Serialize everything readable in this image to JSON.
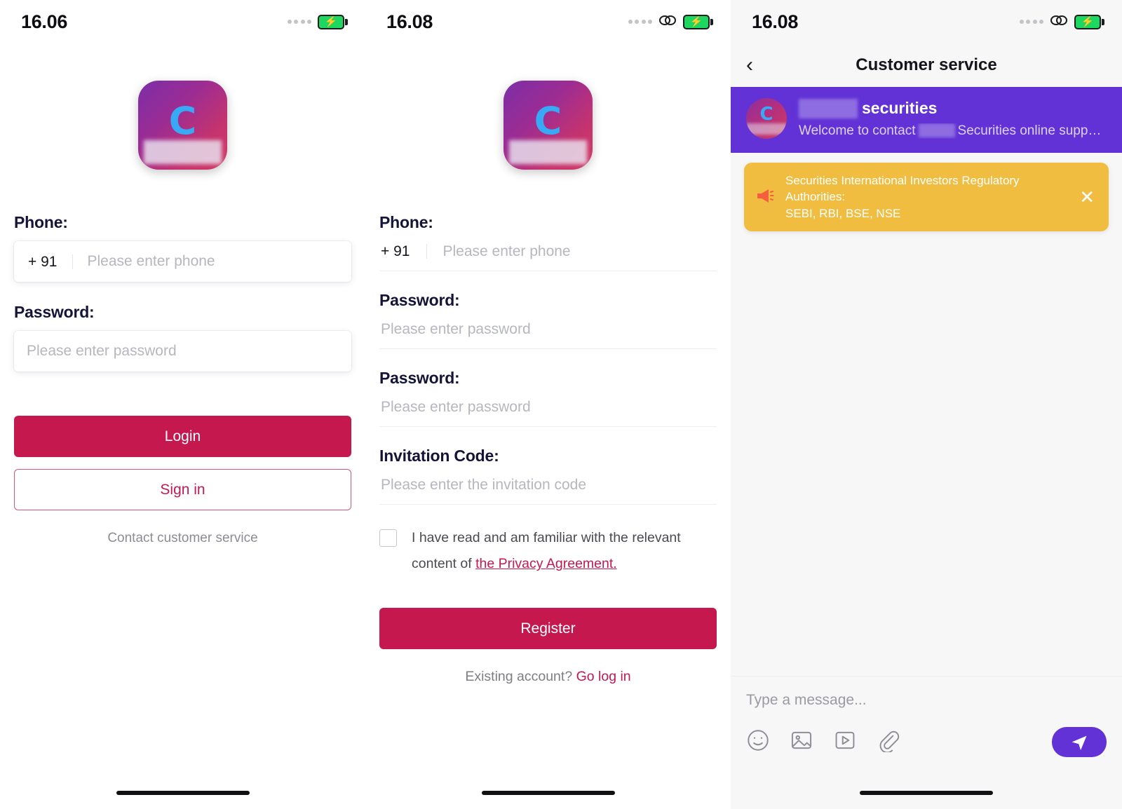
{
  "login": {
    "status": {
      "time": "16.06",
      "battery_state": "charging",
      "has_chain_icon": false
    },
    "logo": {
      "letter": "C",
      "redacted": true
    },
    "phone_label": "Phone:",
    "country_code": "+ 91",
    "phone_placeholder": "Please enter phone",
    "password_label": "Password:",
    "password_placeholder": "Please enter password",
    "login_button": "Login",
    "signin_button": "Sign in",
    "contact_link": "Contact customer service"
  },
  "register": {
    "status": {
      "time": "16.08",
      "battery_state": "charging",
      "has_chain_icon": true
    },
    "logo": {
      "letter": "C",
      "redacted": true
    },
    "phone_label": "Phone:",
    "country_code": "+ 91",
    "phone_placeholder": "Please enter phone",
    "password_label": "Password:",
    "password_placeholder": "Please enter password",
    "confirm_label": "Password:",
    "confirm_placeholder": "Please enter password",
    "invitation_label": "Invitation Code:",
    "invitation_placeholder": "Please enter the invitation code",
    "agreement_text": "I have read and am familiar with the relevant content of",
    "agreement_link": "the Privacy Agreement.",
    "register_button": "Register",
    "existing_prefix": "Existing account?",
    "existing_link": "Go log in"
  },
  "chat": {
    "status": {
      "time": "16.08",
      "battery_state": "charging",
      "has_chain_icon": true
    },
    "nav_title": "Customer service",
    "banner": {
      "brand_suffix": "securities",
      "welcome_prefix": "Welcome to contact",
      "welcome_suffix": "Securities online supp…"
    },
    "notice": {
      "line1": "Securities International Investors Regulatory Authorities:",
      "line2": "SEBI, RBI, BSE, NSE"
    },
    "composer_placeholder": "Type a message...",
    "tools": [
      "emoji-icon",
      "image-icon",
      "video-icon",
      "attachment-icon"
    ]
  },
  "colors": {
    "accent_crimson": "#c4184f",
    "accent_purple": "#6232d6",
    "notice_yellow": "#f0bd40",
    "label_navy": "#141438"
  }
}
